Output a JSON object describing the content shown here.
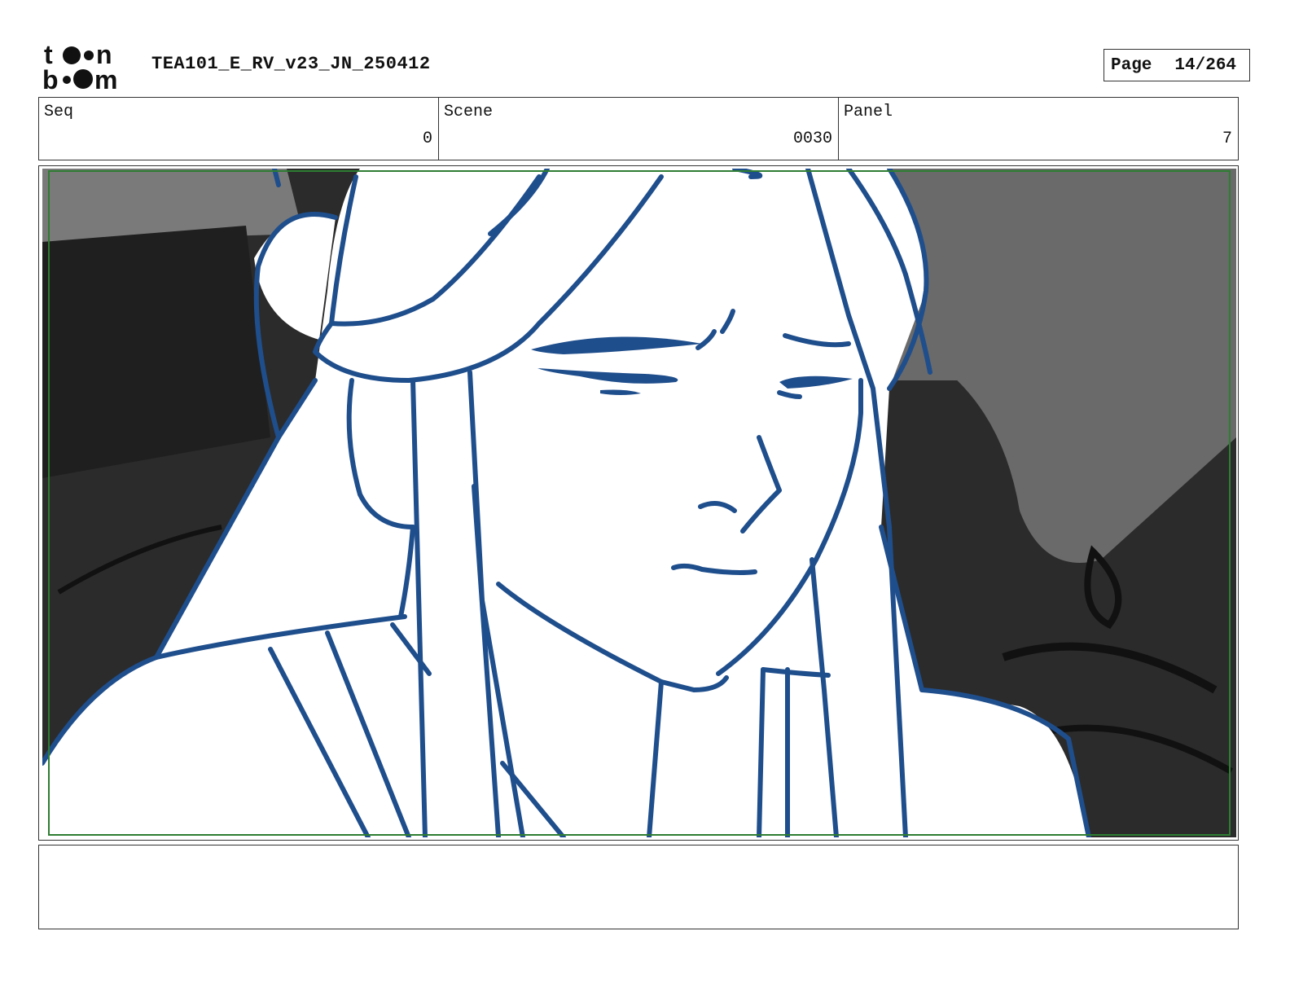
{
  "header": {
    "logo_text": "toon boom",
    "title": "TEA101_E_RV_v23_JN_250412",
    "page_label": "Page",
    "page_value": "14/264"
  },
  "info": {
    "seq_label": "Seq",
    "seq_value": "0",
    "scene_label": "Scene",
    "scene_value": "0030",
    "panel_label": "Panel",
    "panel_value": "7"
  },
  "colors": {
    "line_art": "#1f4e8c",
    "safe_frame": "#2e7d32",
    "background_dark": "#2b2b2b",
    "background_gray": "#6a6a6a"
  },
  "notes": {
    "text": ""
  }
}
